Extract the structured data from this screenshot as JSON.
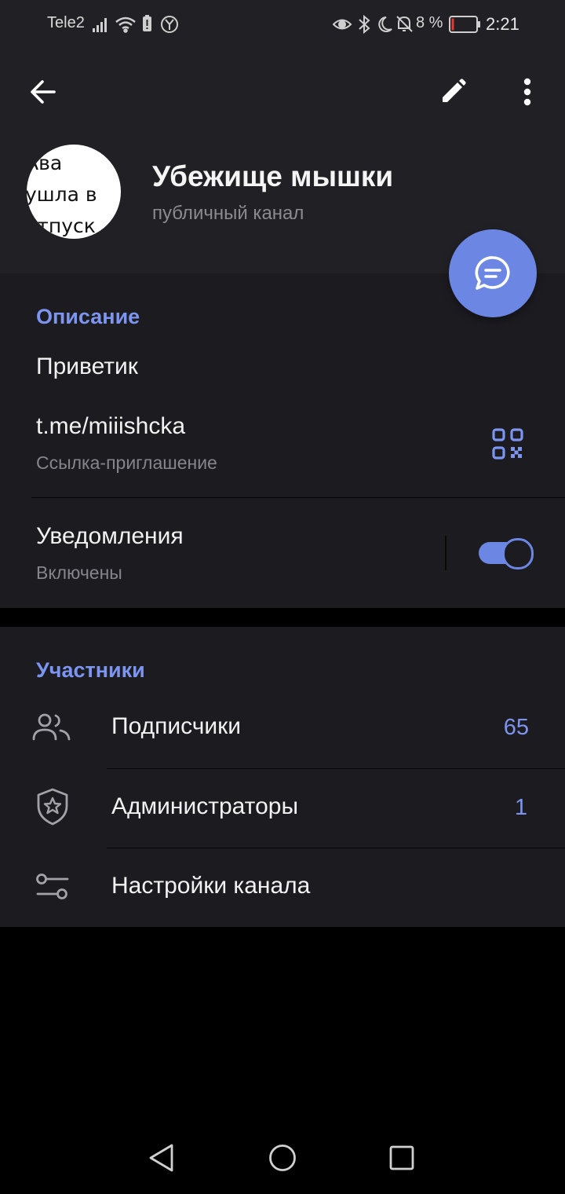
{
  "status_bar": {
    "carrier": "Tele2",
    "battery_percent": "8 %",
    "time": "2:21",
    "icons": [
      "signal-icon",
      "wifi-icon",
      "battery-saver-icon",
      "yandex-icon",
      "eye-icon",
      "bluetooth-icon",
      "moon-icon",
      "bell-off-icon",
      "battery-icon"
    ]
  },
  "header": {
    "back_icon": "arrow-left-icon",
    "edit_icon": "pencil-icon",
    "more_icon": "more-vertical-icon",
    "avatar_text": "Ава\nушла в\nотпуск",
    "title": "Убежище мышки",
    "subtitle": "публичный канал",
    "fab_icon": "chat-bubble-icon"
  },
  "info": {
    "section_title": "Описание",
    "description": "Приветик",
    "link": "t.me/miiishcka",
    "link_caption": "Ссылка-приглашение",
    "qr_icon": "qr-code-icon",
    "notifications_label": "Уведомления",
    "notifications_status": "Включены",
    "notifications_enabled": true
  },
  "members": {
    "section_title": "Участники",
    "items": [
      {
        "label": "Подписчики",
        "count": "65",
        "icon": "people-icon"
      },
      {
        "label": "Администраторы",
        "count": "1",
        "icon": "shield-star-icon"
      },
      {
        "label": "Настройки канала",
        "count": "",
        "icon": "sliders-icon"
      }
    ]
  },
  "nav_bar": {
    "back_icon": "triangle-back-icon",
    "home_icon": "circle-home-icon",
    "recents_icon": "square-recents-icon"
  },
  "colors": {
    "accent": "#7c95f0",
    "fab": "#6c87e3",
    "header_bg": "#212024",
    "section_bg": "#1c1b20",
    "page_bg": "#000000",
    "battery_low": "#e53935"
  }
}
